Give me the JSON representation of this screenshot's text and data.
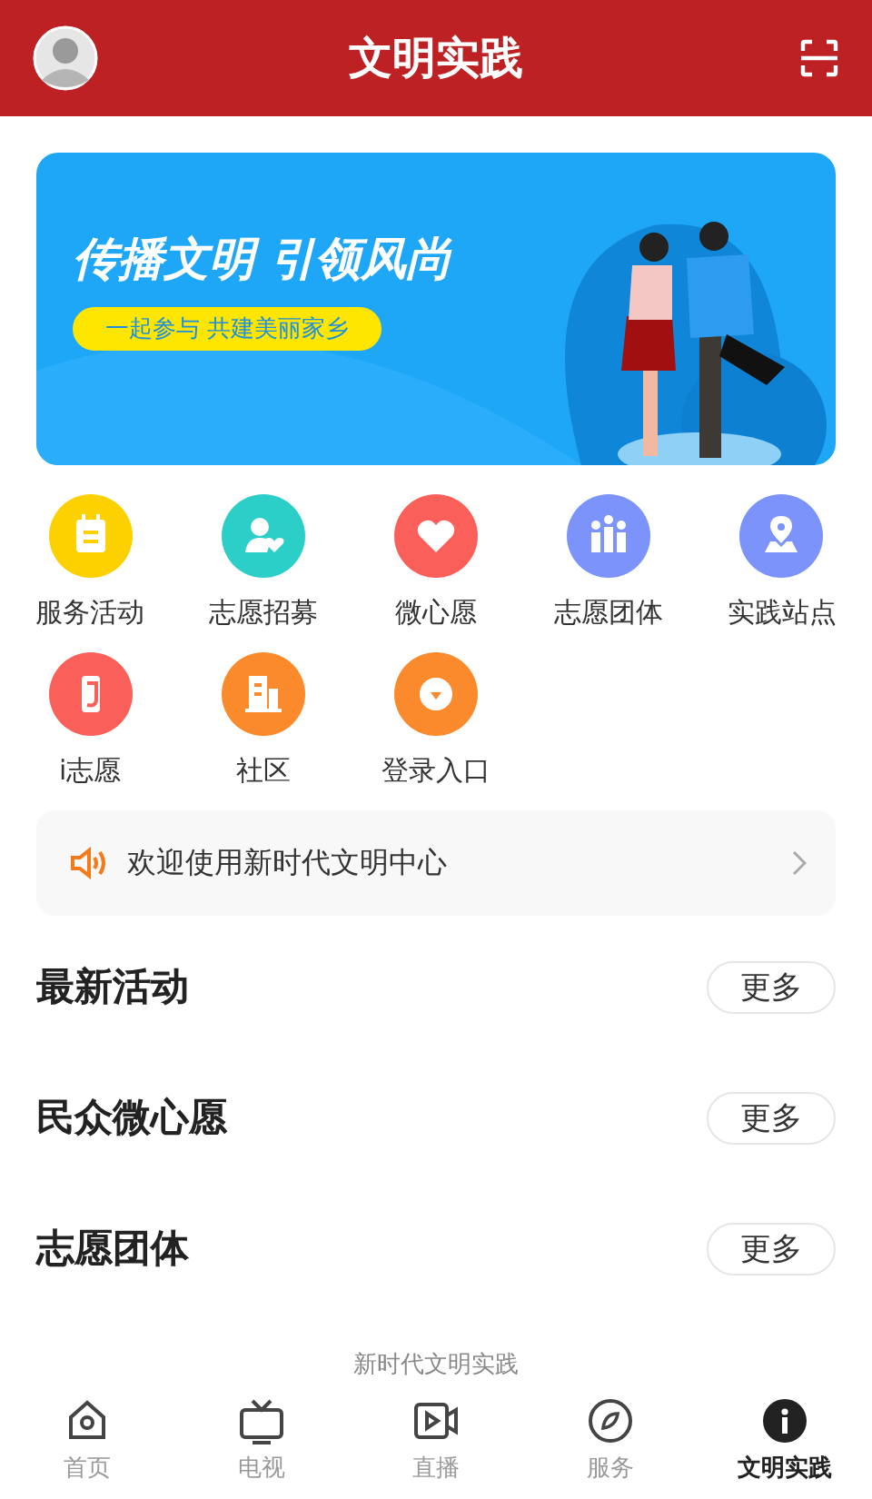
{
  "header": {
    "title": "文明实践"
  },
  "banner": {
    "headline": "传播文明 引领风尚",
    "tagline": "一起参与 共建美丽家乡"
  },
  "shortcuts": [
    {
      "label": "服务活动",
      "color": "#fdd000"
    },
    {
      "label": "志愿招募",
      "color": "#2ccfc8"
    },
    {
      "label": "微心愿",
      "color": "#fb5f5a"
    },
    {
      "label": "志愿团体",
      "color": "#7b93fb"
    },
    {
      "label": "实践站点",
      "color": "#7b93fb"
    },
    {
      "label": "i志愿",
      "color": "#fb5f5a"
    },
    {
      "label": "社区",
      "color": "#fb8a2c"
    },
    {
      "label": "登录入口",
      "color": "#fb8a2c"
    }
  ],
  "notice": {
    "text": "欢迎使用新时代文明中心"
  },
  "sections": [
    {
      "title": "最新活动",
      "more": "更多"
    },
    {
      "title": "民众微心愿",
      "more": "更多"
    },
    {
      "title": "志愿团体",
      "more": "更多"
    }
  ],
  "footer_note": "新时代文明实践",
  "tabs": [
    {
      "label": "首页",
      "selected": false
    },
    {
      "label": "电视",
      "selected": false
    },
    {
      "label": "直播",
      "selected": false
    },
    {
      "label": "服务",
      "selected": false
    },
    {
      "label": "文明实践",
      "selected": true
    }
  ]
}
